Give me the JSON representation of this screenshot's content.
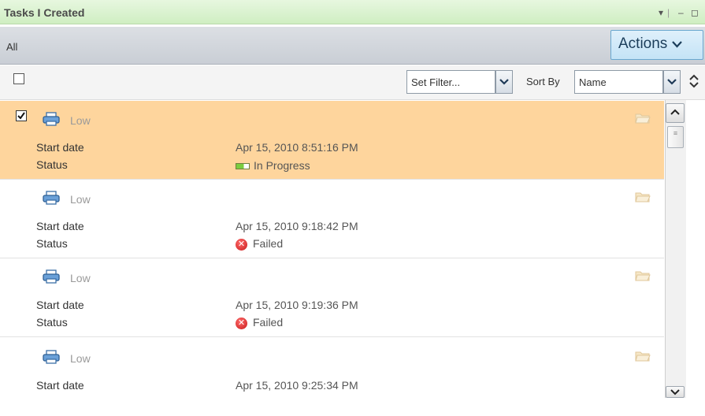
{
  "header": {
    "title": "Tasks I Created",
    "menu_glyph": "▾",
    "minimize_glyph": "‒",
    "restore_glyph": "◻"
  },
  "toolbar": {
    "tab_all": "All",
    "actions_label": "Actions",
    "actions_chevron": "❯"
  },
  "filter": {
    "set_filter_placeholder": "Set Filter...",
    "sort_by_label": "Sort By",
    "sort_by_value": "Name",
    "dropdown_glyph": "⌄",
    "sort_toggle_up": "⌃",
    "sort_toggle_down": "⌄"
  },
  "fields": {
    "start_date": "Start date",
    "status": "Status"
  },
  "tasks": [
    {
      "priority": "Low",
      "start_date": "Apr 15, 2010 8:51:16 PM",
      "status": "In Progress",
      "selected": true,
      "status_icon": "progress-icon"
    },
    {
      "priority": "Low",
      "start_date": "Apr 15, 2010 9:18:42 PM",
      "status": "Failed",
      "selected": false,
      "status_icon": "failed-icon"
    },
    {
      "priority": "Low",
      "start_date": "Apr 15, 2010 9:19:36 PM",
      "status": "Failed",
      "selected": false,
      "status_icon": "failed-icon"
    },
    {
      "priority": "Low",
      "start_date": "Apr 15, 2010 9:25:34 PM",
      "status": "",
      "selected": false,
      "status_icon": ""
    }
  ],
  "scrollbar": {
    "up_glyph": "▲",
    "down_glyph": "▼",
    "thumb_grip": "≡"
  },
  "colors": {
    "selected_row": "#fed59d",
    "title_bar": "#d9f2cf",
    "actions_button": "#cfe8f8",
    "failed": "#d12020",
    "progress": "#7bcd3f"
  }
}
